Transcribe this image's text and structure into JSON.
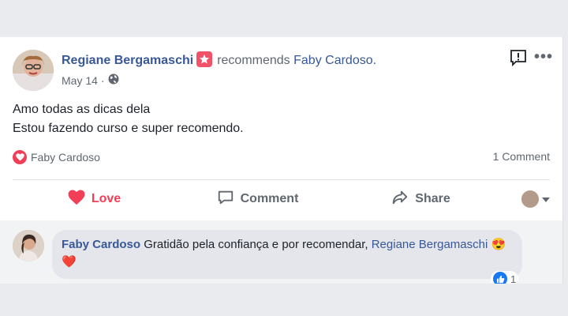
{
  "post": {
    "author": "Regiane Bergamaschi",
    "action": "recommends",
    "page": "Faby Cardoso.",
    "date": "May 14",
    "separator": "·",
    "text_lines": [
      "Amo todas as dicas dela",
      "Estou fazendo curso e super recomendo."
    ]
  },
  "reactions": {
    "reactor": "Faby Cardoso",
    "comments_count": "1 Comment"
  },
  "actions": {
    "love": "Love",
    "comment": "Comment",
    "share": "Share"
  },
  "comment": {
    "author": "Faby Cardoso",
    "text": "Gratidão pela confiança e por recomendar,",
    "mention": "Regiane Bergamaschi",
    "emojis": "😍 ❤️",
    "likes": "1"
  },
  "colors": {
    "link": "#385898",
    "love": "#f33e58",
    "like": "#1877f2"
  }
}
